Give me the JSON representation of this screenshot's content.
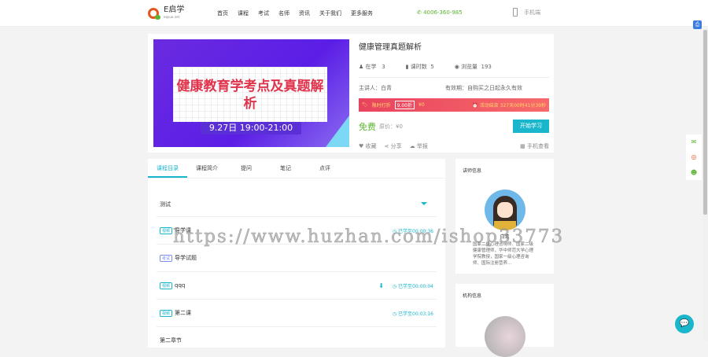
{
  "header": {
    "logo_text": "E启学",
    "logo_sub": "eqxue.net",
    "nav": [
      "首页",
      "课程",
      "考试",
      "名师",
      "资讯",
      "关于我们",
      "更多服务"
    ],
    "phone": "4006-360-985",
    "mobile": "手机端"
  },
  "course": {
    "banner_title": "健康教育学考点及真题解析",
    "banner_date": "9.27日 19:00-21:00",
    "title": "健康管理真题解析",
    "stats": [
      {
        "label": "在学",
        "value": "3"
      },
      {
        "label": "课时数",
        "value": "5"
      },
      {
        "label": "浏览量",
        "value": "193"
      }
    ],
    "teacher": "主讲人：白青",
    "validity": "有效期：自购买之日起永久有效",
    "promo": {
      "label": "限时打折",
      "discount": "9.00折",
      "price": "¥0",
      "countdown": "活动结束 327天00时41分39秒"
    },
    "free": "免费",
    "orig_price": "原价：¥0",
    "start": "开始学习",
    "actions": [
      "收藏",
      "分享",
      "举报"
    ],
    "mobile_view": "手机查看"
  },
  "tabs": [
    "课程目录",
    "课程简介",
    "提问",
    "笔记",
    "点评"
  ],
  "section": "测试",
  "items": [
    {
      "tag": "视频",
      "title": "导学课",
      "progress": "已学至00:00:36"
    },
    {
      "tag": "考试",
      "title": "导学试题",
      "progress": ""
    },
    {
      "tag": "视频",
      "title": "qqq",
      "progress": "已学至00:00:04"
    },
    {
      "tag": "视频",
      "title": "第二课",
      "progress": "已学至00:03:16"
    }
  ],
  "next_section": "第二章节",
  "sidebar": {
    "teacher_title": "讲师信息",
    "teacher_name": "白青",
    "teacher_desc": "国家二级心理咨询师、国家二级健康管理师，华中师范大学心理学院教授，国家一级心理咨询师、国际注册营养...",
    "org_title": "机构信息"
  },
  "watermark": "https://www.huzhan.com/ishop33773",
  "colors": {
    "accent": "#1ab6cc",
    "green": "#5cb531",
    "promo": "#e8435e"
  }
}
